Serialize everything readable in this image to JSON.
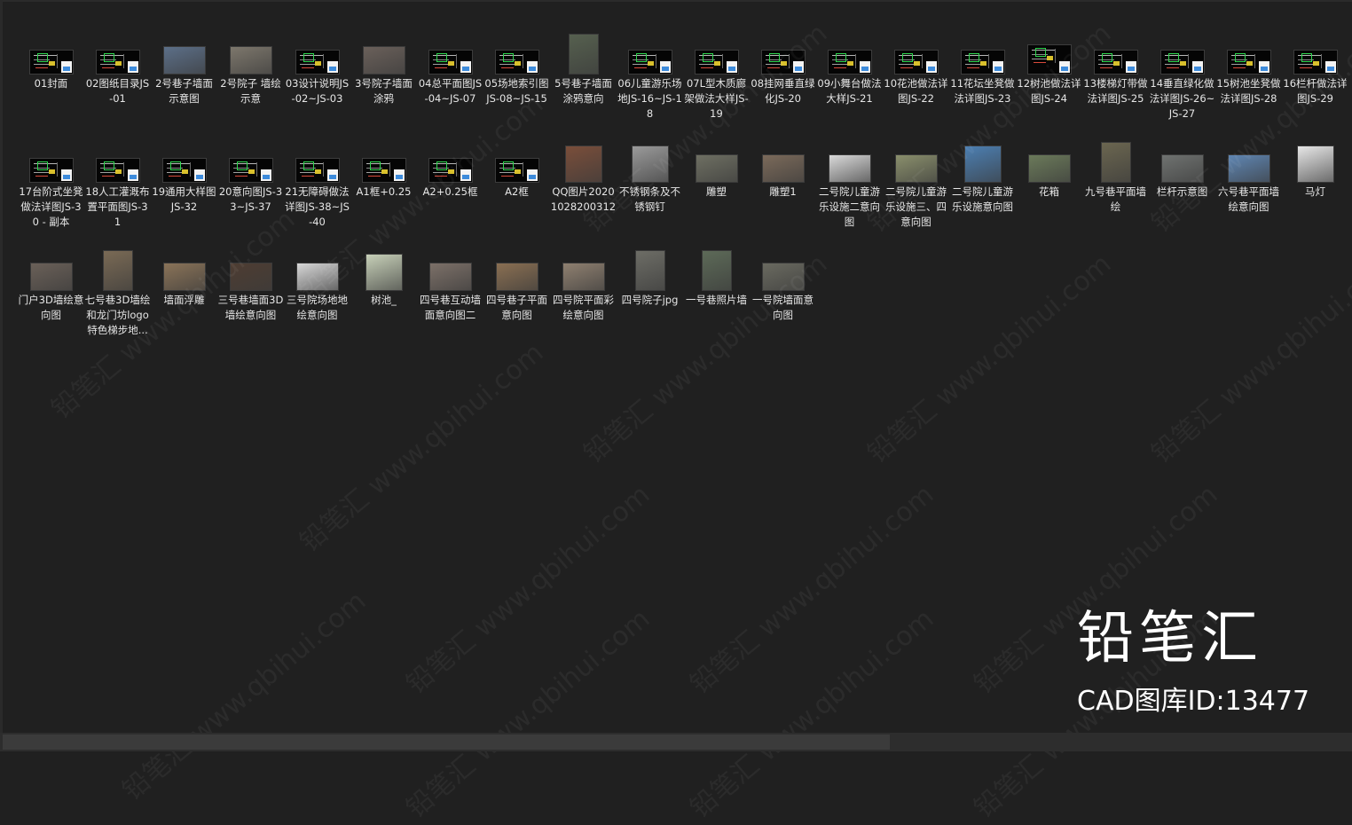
{
  "files": [
    {
      "name": "01封面",
      "kind": "dwg"
    },
    {
      "name": "02图纸目录JS-01",
      "kind": "dwg"
    },
    {
      "name": "2号巷子墙面示意图",
      "kind": "img",
      "color": "#5c6f88"
    },
    {
      "name": "2号院子 墙绘示意",
      "kind": "img",
      "color": "#7d776c"
    },
    {
      "name": "03设计说明JS-02~JS-03",
      "kind": "dwg"
    },
    {
      "name": "3号院子墙面涂鸦",
      "kind": "img",
      "color": "#6a605a"
    },
    {
      "name": "04总平面图JS-04~JS-07",
      "kind": "dwg"
    },
    {
      "name": "05场地索引图JS-08~JS-15",
      "kind": "dwg"
    },
    {
      "name": "5号巷子墙面涂鸦意向",
      "kind": "img",
      "color": "#56604f",
      "shape": "tall"
    },
    {
      "name": "06儿童游乐场地JS-16~JS-18",
      "kind": "dwg"
    },
    {
      "name": "07L型木质廊架做法大样JS-19",
      "kind": "dwg"
    },
    {
      "name": "08挂网垂直绿化JS-20",
      "kind": "dwg"
    },
    {
      "name": "09小舞台做法大样JS-21",
      "kind": "dwg"
    },
    {
      "name": "10花池做法详图JS-22",
      "kind": "dwg"
    },
    {
      "name": "11花坛坐凳做法详图JS-23",
      "kind": "dwg"
    },
    {
      "name": "12树池做法详图JS-24",
      "kind": "dwg",
      "shape": "tall"
    },
    {
      "name": "13楼梯灯带做法详图JS-25",
      "kind": "dwg"
    },
    {
      "name": "14垂直绿化做法详图JS-26~JS-27",
      "kind": "dwg"
    },
    {
      "name": "15树池坐凳做法详图JS-28",
      "kind": "dwg"
    },
    {
      "name": "16栏杆做法详图JS-29",
      "kind": "dwg"
    },
    {
      "name": "17台阶式坐凳做法详图JS-30 - 副本",
      "kind": "dwg"
    },
    {
      "name": "18人工灌溉布置平面图JS-31",
      "kind": "dwg"
    },
    {
      "name": "19通用大样图JS-32",
      "kind": "dwg"
    },
    {
      "name": "20意向图JS-33~JS-37",
      "kind": "dwg"
    },
    {
      "name": "21无障碍做法详图JS-38~JS-40",
      "kind": "dwg"
    },
    {
      "name": "A1框+0.25",
      "kind": "dwg"
    },
    {
      "name": "A2+0.25框",
      "kind": "dwg"
    },
    {
      "name": "A2框",
      "kind": "dwg"
    },
    {
      "name": "QQ图片20201028200312",
      "kind": "img",
      "color": "#7a4e3a",
      "shape": "sq"
    },
    {
      "name": "不锈钢条及不锈钢钉",
      "kind": "img",
      "color": "#9a9a9a",
      "shape": "sq"
    },
    {
      "name": "雕塑",
      "kind": "img",
      "color": "#6e6f62"
    },
    {
      "name": "雕塑1",
      "kind": "img",
      "color": "#7b6a5a"
    },
    {
      "name": "二号院儿童游乐设施二意向图",
      "kind": "img",
      "color": "#d9d9d9"
    },
    {
      "name": "二号院儿童游乐设施三、四意向图",
      "kind": "img",
      "color": "#8a8f6c"
    },
    {
      "name": "二号院儿童游乐设施意向图",
      "kind": "img",
      "color": "#4c7fb2",
      "shape": "sq"
    },
    {
      "name": "花箱",
      "kind": "img",
      "color": "#6b7a5a"
    },
    {
      "name": "九号巷平面墙绘",
      "kind": "img",
      "color": "#6b6650",
      "shape": "tall"
    },
    {
      "name": "栏杆示意图",
      "kind": "img",
      "color": "#6f7270"
    },
    {
      "name": "六号巷平面墙绘意向图",
      "kind": "img",
      "color": "#5f86b3"
    },
    {
      "name": "马灯",
      "kind": "img",
      "color": "#e7e7e7",
      "shape": "sq"
    },
    {
      "name": "门户3D墙绘意向图",
      "kind": "img",
      "color": "#6a6058"
    },
    {
      "name": "七号巷3D墙绘和龙门坊logo特色梯步地...",
      "kind": "img",
      "color": "#7a6a55",
      "shape": "tall"
    },
    {
      "name": "墙面浮雕",
      "kind": "img",
      "color": "#8a7358"
    },
    {
      "name": "三号巷墙面3D墙绘意向图",
      "kind": "img",
      "color": "#4e3d32"
    },
    {
      "name": "三号院场地地绘意向图",
      "kind": "img",
      "color": "#d8d8d8"
    },
    {
      "name": "树池_",
      "kind": "img",
      "color": "#c7d0b8",
      "shape": "sq"
    },
    {
      "name": "四号巷互动墙面意向图二",
      "kind": "img",
      "color": "#7c7068"
    },
    {
      "name": "四号巷子平面意向图",
      "kind": "img",
      "color": "#8a6f52"
    },
    {
      "name": "四号院平面彩绘意向图",
      "kind": "img",
      "color": "#8f8070"
    },
    {
      "name": "四号院子jpg",
      "kind": "img",
      "color": "#6d6d66",
      "shape": "tall"
    },
    {
      "name": "一号巷照片墙",
      "kind": "img",
      "color": "#5d6a58",
      "shape": "tall"
    },
    {
      "name": "一号院墙面意向图",
      "kind": "img",
      "color": "#6a6a60"
    }
  ],
  "watermark": {
    "text": "铅笔汇 www.qbihui.com"
  },
  "brand": {
    "name": "铅笔汇",
    "id_text": "CAD图库ID:13477"
  }
}
